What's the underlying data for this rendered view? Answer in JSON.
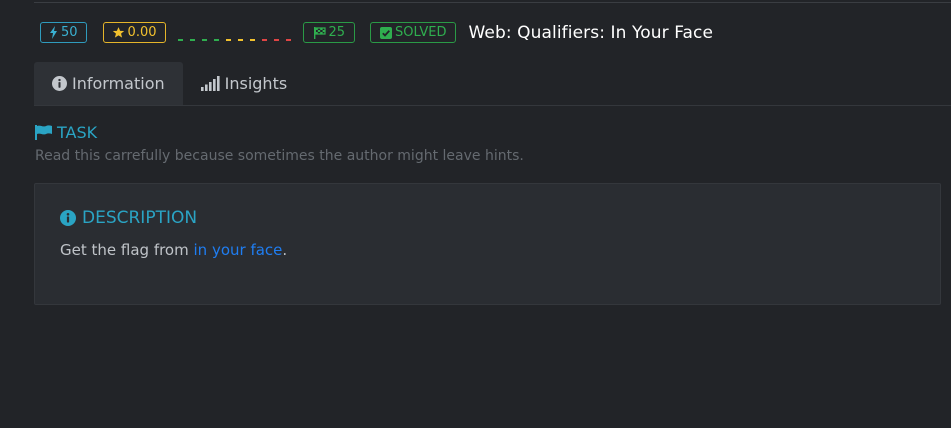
{
  "header": {
    "points": "50",
    "rating": "0.00",
    "solves": "25",
    "status": "SOLVED",
    "title": "Web: Qualifiers: In Your Face",
    "difficulty_colors": [
      "#2fae4f",
      "#2fae4f",
      "#2fae4f",
      "#2fae4f",
      "#f2c12e",
      "#f2c12e",
      "#f2c12e",
      "#e04545",
      "#e04545",
      "#e04545"
    ]
  },
  "tabs": [
    {
      "label": "Information",
      "icon": "info-circle-icon",
      "active": true
    },
    {
      "label": "Insights",
      "icon": "signal-bars-icon",
      "active": false
    }
  ],
  "task": {
    "heading": "TASK",
    "description": "Read this carrefully because sometimes the author might leave hints."
  },
  "description": {
    "heading": "DESCRIPTION",
    "text_prefix": "Get the flag from ",
    "link_text": "in your face",
    "text_suffix": "."
  },
  "colors": {
    "accent": "#2aa4c4",
    "link": "#1f7df1",
    "success": "#2fae4f",
    "warning": "#f2c12e",
    "background": "#222428",
    "card": "#2a2d32"
  }
}
